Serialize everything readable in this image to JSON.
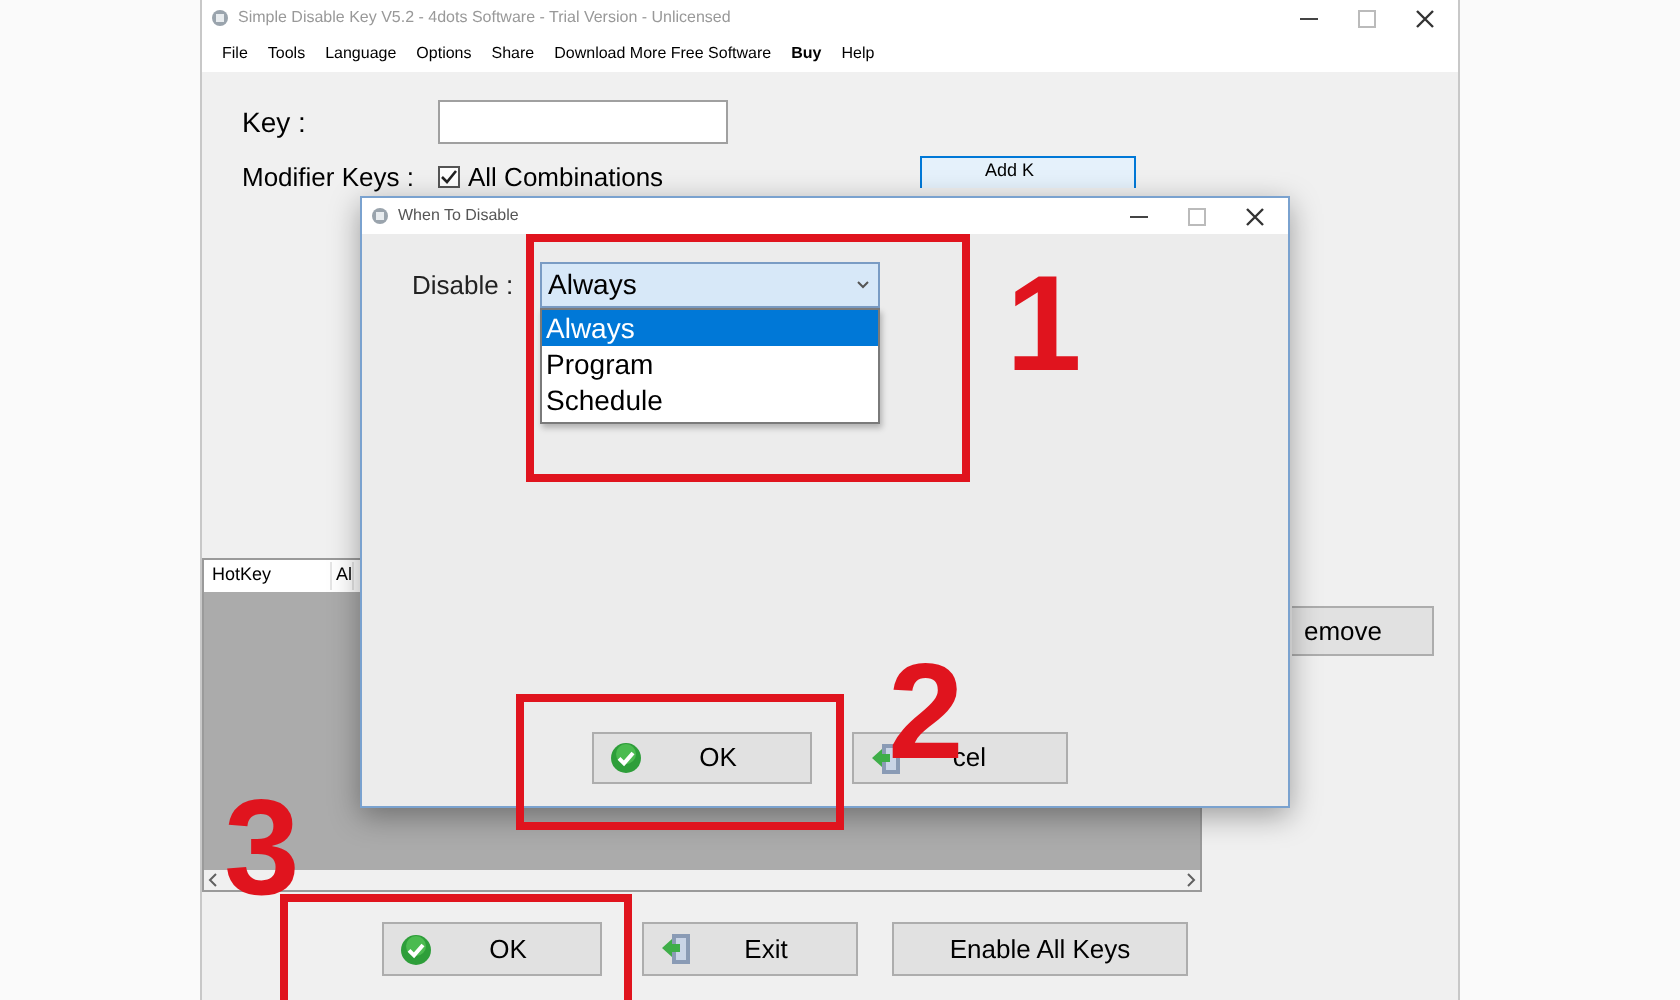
{
  "main_window": {
    "title": "Simple Disable Key V5.2 - 4dots Software - Trial Version - Unlicensed",
    "menu": [
      {
        "label": "File",
        "emphasized": false
      },
      {
        "label": "Tools",
        "emphasized": false
      },
      {
        "label": "Language",
        "emphasized": false
      },
      {
        "label": "Options",
        "emphasized": false
      },
      {
        "label": "Share",
        "emphasized": false
      },
      {
        "label": "Download More Free Software",
        "emphasized": false
      },
      {
        "label": "Buy",
        "emphasized": true
      },
      {
        "label": "Help",
        "emphasized": false
      }
    ],
    "key_label": "Key :",
    "modifier_label": "Modifier Keys :",
    "all_combinations": {
      "label": "All Combinations",
      "checked": true
    },
    "add_key_button": "Add K",
    "list": {
      "columns": [
        "HotKey",
        "Al"
      ]
    },
    "remove_button": "emove",
    "buttons": [
      {
        "label": "OK",
        "kind": "ok"
      },
      {
        "label": "Exit",
        "kind": "exit"
      },
      {
        "label": "Enable All Keys",
        "kind": "plain"
      }
    ]
  },
  "dialog": {
    "title": "When To Disable",
    "disable_label": "Disable :",
    "combo_value": "Always",
    "options": [
      {
        "label": "Always",
        "selected": true
      },
      {
        "label": "Program",
        "selected": false
      },
      {
        "label": "Schedule",
        "selected": false
      }
    ],
    "buttons": [
      {
        "label": "OK",
        "kind": "ok"
      },
      {
        "label": "cel",
        "kind": "exit"
      }
    ]
  },
  "annotations": [
    {
      "number": "1"
    },
    {
      "number": "2"
    },
    {
      "number": "3"
    }
  ]
}
